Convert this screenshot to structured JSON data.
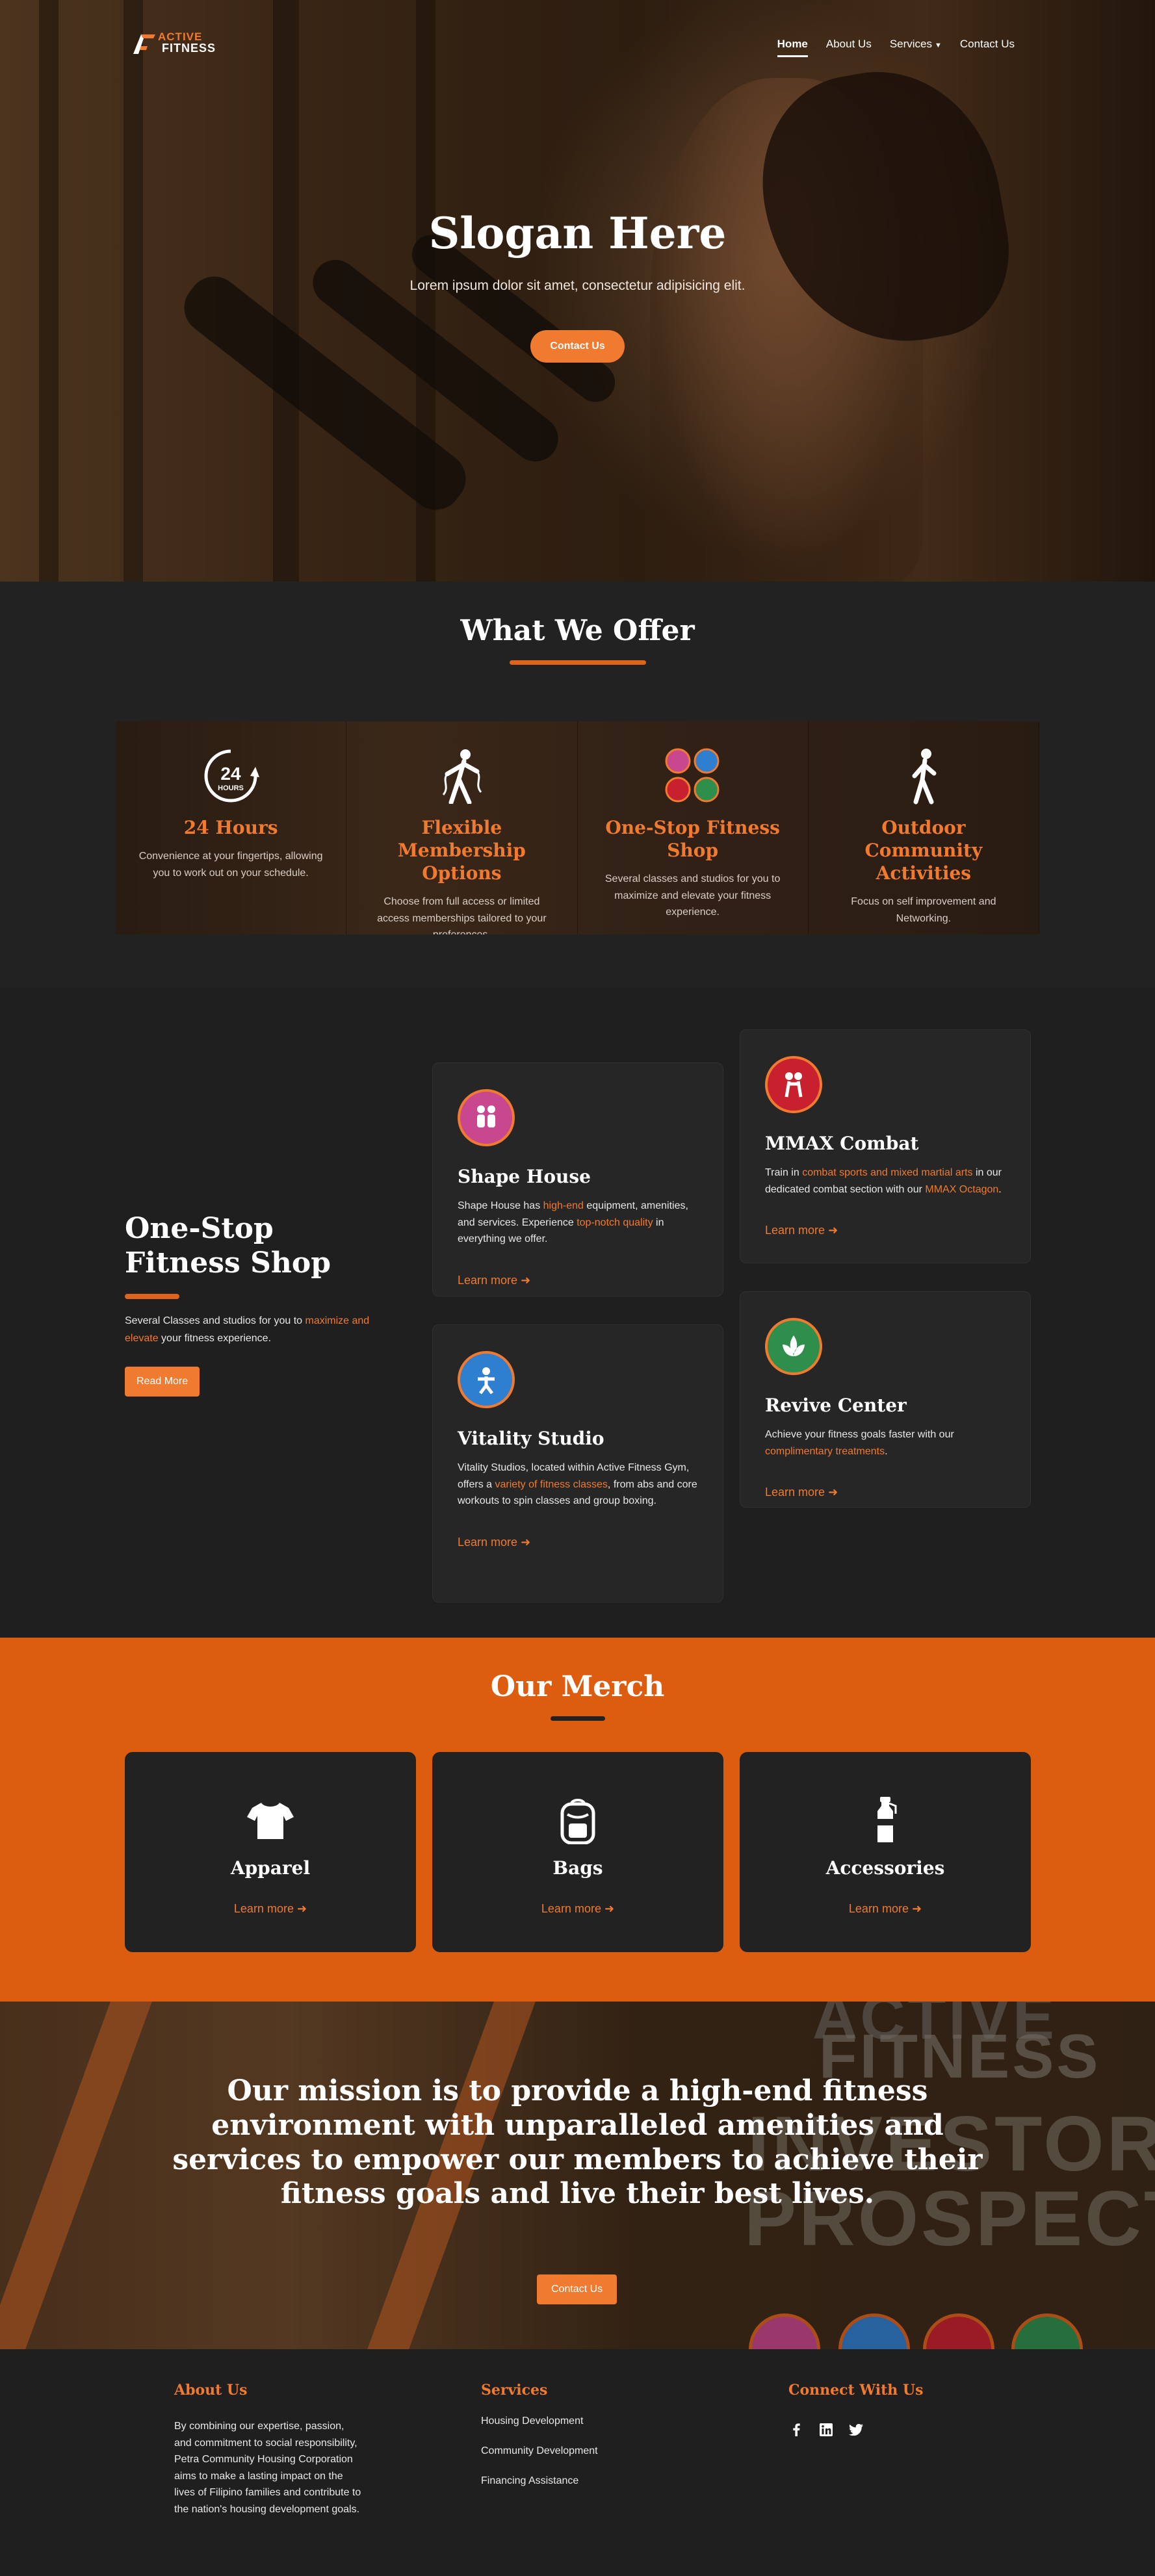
{
  "nav": {
    "logo_top": "ACTIVE",
    "logo_bottom": "FITNESS",
    "items": [
      {
        "label": "Home"
      },
      {
        "label": "About Us"
      },
      {
        "label": "Services"
      },
      {
        "label": "Contact Us"
      }
    ]
  },
  "hero": {
    "title": "Slogan Here",
    "subtitle": "Lorem ipsum dolor sit amet, consectetur adipisicing elit.",
    "button": "Contact Us"
  },
  "offer": {
    "title": "What We Offer",
    "cards": [
      {
        "title": "24 Hours",
        "text": "Convenience at your fingertips, allowing you to work out on your schedule.",
        "icon": "24-hours-icon"
      },
      {
        "title": "Flexible Membership Options",
        "text": "Choose from full access or limited access memberships tailored to your preferences.",
        "icon": "battle-rope-icon"
      },
      {
        "title": "One-Stop Fitness Shop",
        "text": "Several classes and studios for you to maximize and elevate your fitness experience.",
        "icon": "studio-badges-icon"
      },
      {
        "title": "Outdoor Community Activities",
        "text": "Focus on self improvement and Networking.",
        "icon": "runner-icon"
      }
    ]
  },
  "shop": {
    "title": "One-Stop Fitness Shop",
    "desc_1": "Several Classes and studios for you to ",
    "desc_hl": "maximize and elevate",
    "desc_2": " your fitness experience.",
    "button": "Read More",
    "services": {
      "shape": {
        "title": "Shape House",
        "t1": "Shape House has ",
        "h1": "high-end",
        "t2": " equipment, amenities, and services. Experience ",
        "h2": "top-notch quality",
        "t3": " in everything we offer.",
        "more": "Learn more",
        "badge_color": "#c9478f"
      },
      "mmax": {
        "title": "MMAX Combat",
        "t1": "Train in ",
        "h1": "combat sports and mixed martial arts",
        "t2": " in our dedicated combat section with our ",
        "h2": "MMAX Octagon",
        "t3": ".",
        "more": "Learn more",
        "badge_color": "#c8202f"
      },
      "vitality": {
        "title": "Vitality Studio",
        "t1": "Vitality Studios, located within Active Fitness Gym, offers a ",
        "h1": "variety of fitness classes",
        "t2": ", from abs and core workouts to spin classes and group boxing.",
        "more": "Learn more",
        "badge_color": "#2f7fd0"
      },
      "revive": {
        "title": "Revive Center",
        "t1": "Achieve your fitness goals faster with our ",
        "h1": "complimentary treatments",
        "t2": ".",
        "more": "Learn more",
        "badge_color": "#2e8f4c"
      }
    }
  },
  "merch": {
    "title": "Our Merch",
    "items": [
      {
        "title": "Apparel",
        "more": "Learn more",
        "icon": "shirt-icon"
      },
      {
        "title": "Bags",
        "more": "Learn more",
        "icon": "backpack-icon"
      },
      {
        "title": "Accessories",
        "more": "Learn more",
        "icon": "bottle-icon"
      }
    ]
  },
  "mission": {
    "text": "Our mission is to provide a high-end fitness environment with unparalleled amenities and services to empower our members to achieve their fitness goals and live their best lives.",
    "button": "Contact Us",
    "bg_brand_1": "ACTIVE",
    "bg_brand_2": "FITNESS",
    "bg_line_1": "INVESTOR",
    "bg_line_2": "PROSPECTUS"
  },
  "footer": {
    "about_title": "About Us",
    "about_text": "By combining our expertise, passion, and commitment to social responsibility, Petra Community Housing Corporation aims to make a lasting impact on the lives of Filipino families and contribute to the nation's housing development goals.",
    "services_title": "Services",
    "services": [
      "Housing Development",
      "Community Development",
      "Financing Assistance"
    ],
    "connect_title": "Connect With Us",
    "social": [
      "facebook-icon",
      "linkedin-icon",
      "twitter-icon"
    ]
  },
  "colors": {
    "accent": "#f07a30",
    "merch_bg": "#dd5d10",
    "dark": "#222222"
  }
}
